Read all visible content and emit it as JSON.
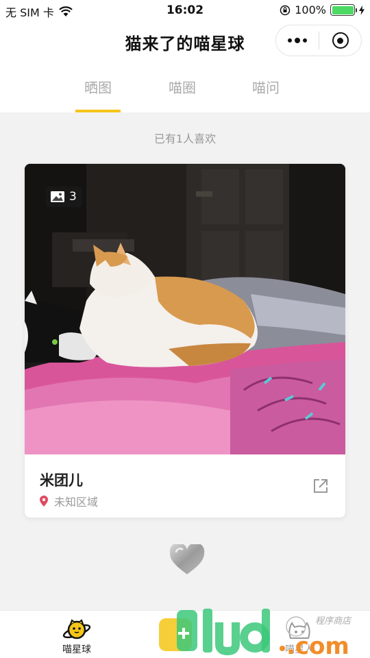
{
  "status_bar": {
    "carrier": "无 SIM 卡",
    "time": "16:02",
    "battery_percent": "100%",
    "battery_level": 1.0
  },
  "nav": {
    "title": "猫来了的喵星球"
  },
  "tabs": [
    {
      "label": "晒图",
      "active": true
    },
    {
      "label": "喵圈",
      "active": false
    },
    {
      "label": "喵问",
      "active": false
    }
  ],
  "feed": {
    "like_text": "已有1人喜欢"
  },
  "card": {
    "image_count": "3",
    "name": "米团儿",
    "location": "未知区域"
  },
  "tab_bar": {
    "items": [
      {
        "label": "喵星球",
        "icon": "planet-cat-icon",
        "active": true
      },
      {
        "label": "喵星人",
        "icon": "cat-face-icon",
        "active": false
      }
    ]
  },
  "watermark": {
    "text": "9lud.com",
    "sub": "程序商店"
  },
  "colors": {
    "accent": "#f5c518",
    "location_pin": "#e04a5f"
  }
}
